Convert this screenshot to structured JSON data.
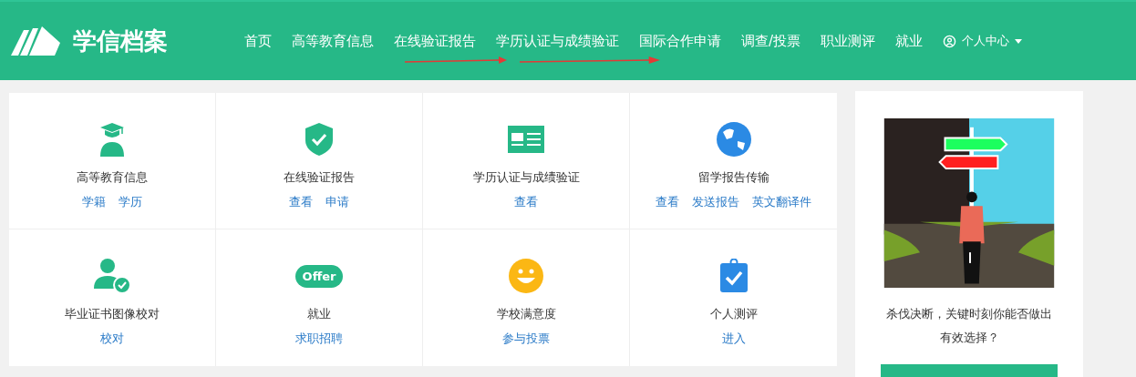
{
  "header": {
    "logo_text": "学信档案",
    "nav": [
      {
        "label": "首页"
      },
      {
        "label": "高等教育信息"
      },
      {
        "label": "在线验证报告"
      },
      {
        "label": "学历认证与成绩验证"
      },
      {
        "label": "国际合作申请"
      },
      {
        "label": "调查/投票"
      },
      {
        "label": "职业测评"
      },
      {
        "label": "就业"
      }
    ],
    "user_menu": {
      "label": "个人中心",
      "expanded": false
    }
  },
  "services": [
    {
      "title": "高等教育信息",
      "links": [
        "学籍",
        "学历"
      ]
    },
    {
      "title": "在线验证报告",
      "links": [
        "查看",
        "申请"
      ]
    },
    {
      "title": "学历认证与成绩验证",
      "links": [
        "查看"
      ]
    },
    {
      "title": "留学报告传输",
      "links": [
        "查看",
        "发送报告",
        "英文翻译件"
      ]
    },
    {
      "title": "毕业证书图像校对",
      "links": [
        "校对"
      ]
    },
    {
      "title": "就业",
      "links": [
        "求职招聘"
      ],
      "badge": "Offer"
    },
    {
      "title": "学校满意度",
      "links": [
        "参与投票"
      ]
    },
    {
      "title": "个人测评",
      "links": [
        "进入"
      ]
    }
  ],
  "sidebar": {
    "caption": "杀伐决断，关键时刻你能否做出有效选择？"
  }
}
